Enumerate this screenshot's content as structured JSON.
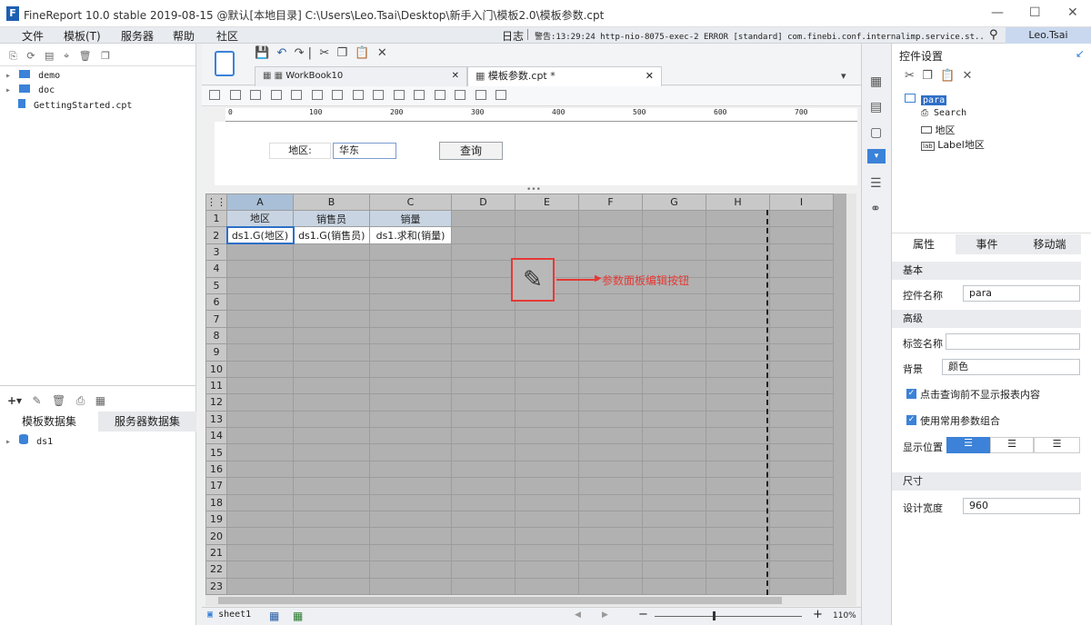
{
  "window": {
    "title": "FineReport 10.0 stable 2019-08-15 @默认[本地目录]    C:\\Users\\Leo.Tsai\\Desktop\\新手入门\\模板2.0\\模板参数.cpt",
    "min": "—",
    "max": "☐",
    "close": "✕"
  },
  "menu": {
    "items": [
      "文件",
      "模板(T)",
      "服务器",
      "帮助",
      "社区"
    ]
  },
  "statusline": {
    "log": "日志",
    "warning": "警告:13:29:24 http-nio-8075-exec-2 ERROR [standard] com.finebi.conf.internalimp.service.st...",
    "user": "Leo.Tsai"
  },
  "filetree": {
    "items": [
      "demo",
      "doc",
      "GettingStarted.cpt"
    ]
  },
  "datasets": {
    "tabs": [
      "模板数据集",
      "服务器数据集"
    ],
    "items": [
      "ds1"
    ]
  },
  "tabs": [
    {
      "label": "WorkBook10"
    },
    {
      "label": "模板参数.cpt *"
    }
  ],
  "ruler": {
    "ticks": [
      "0",
      "100",
      "200",
      "300",
      "400",
      "500",
      "600",
      "700"
    ]
  },
  "param": {
    "label": "地区:",
    "value": "华东",
    "button": "查询"
  },
  "sheet": {
    "columns": [
      "A",
      "B",
      "C",
      "D",
      "E",
      "F",
      "G",
      "H",
      "I"
    ],
    "rows": [
      "1",
      "2",
      "3",
      "4",
      "5",
      "6",
      "7",
      "8",
      "9",
      "10",
      "11",
      "12",
      "13",
      "14",
      "15",
      "16",
      "17",
      "18",
      "19",
      "20",
      "21",
      "22",
      "23"
    ],
    "cells": {
      "r1": [
        "地区",
        "销售员",
        "销量"
      ],
      "r2": [
        "ds1.G(地区)",
        "ds1.G(销售员)",
        "ds1.求和(销量)"
      ]
    },
    "annotation": "参数面板编辑按钮",
    "sheet_tab": "sheet1",
    "zoom": "110%"
  },
  "panel": {
    "title": "控件设置",
    "tree": [
      "para",
      "Search",
      "地区",
      "Label地区"
    ],
    "tabs": [
      "属性",
      "事件",
      "移动端"
    ],
    "sections": {
      "basic": "基本",
      "advanced": "高级",
      "size": "尺寸"
    },
    "fields": {
      "name_label": "控件名称",
      "name_value": "para",
      "tag_label": "标签名称",
      "tag_value": "",
      "bg_label": "背景",
      "bg_value": "颜色",
      "chk1": "点击查询前不显示报表内容",
      "chk2": "使用常用参数组合",
      "pos_label": "显示位置",
      "width_label": "设计宽度",
      "width_value": "960"
    }
  },
  "colors": {
    "accent": "#3b82d8",
    "annotation": "#e53935",
    "grid_bg": "#b1b1b1"
  }
}
